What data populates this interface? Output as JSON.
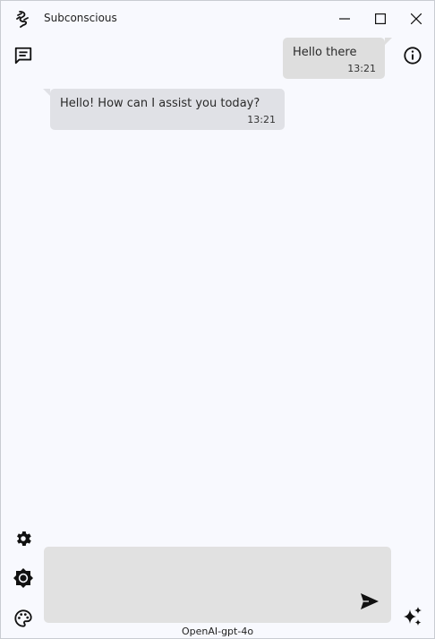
{
  "window": {
    "title": "Subconscious"
  },
  "titlebar": {
    "logo_icon": "subconscious-logo-icon",
    "minimize_icon": "minimize-icon",
    "maximize_icon": "maximize-icon",
    "close_icon": "close-icon"
  },
  "sidebar": {
    "chat_history_icon": "chat-history-icon",
    "info_icon": "info-icon",
    "settings_icon": "gear-icon",
    "brightness_icon": "brightness-icon",
    "palette_icon": "palette-icon",
    "sparkle_icon": "sparkle-icon"
  },
  "messages": [
    {
      "role": "user",
      "text": "Hello there",
      "time": "13:21"
    },
    {
      "role": "assistant",
      "text": "Hello! How can I assist you today?",
      "time": "13:21"
    }
  ],
  "composer": {
    "value": "",
    "placeholder": "",
    "send_icon": "send-icon"
  },
  "model": {
    "name": "OpenAI-gpt-4o"
  },
  "colors": {
    "background": "#f8f9fe",
    "bubble": "#e0e1e6",
    "input": "#e1e1e1",
    "icon": "#111111"
  }
}
